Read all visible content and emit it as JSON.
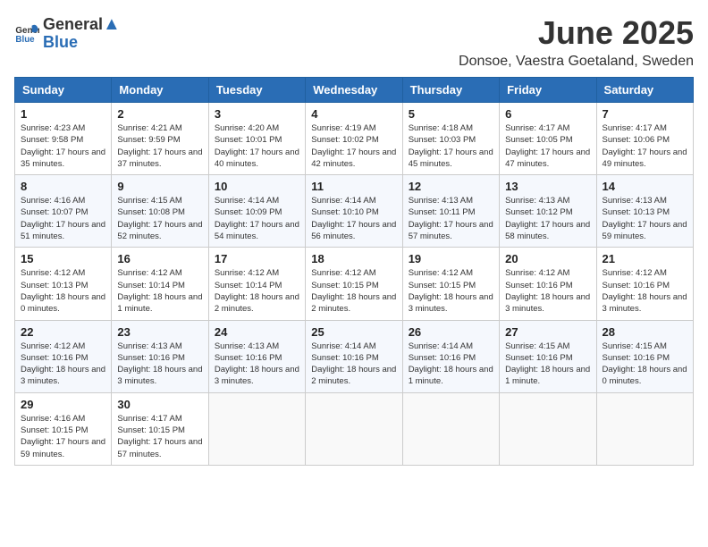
{
  "logo": {
    "text_general": "General",
    "text_blue": "Blue"
  },
  "title": "June 2025",
  "location": "Donsoe, Vaestra Goetaland, Sweden",
  "weekdays": [
    "Sunday",
    "Monday",
    "Tuesday",
    "Wednesday",
    "Thursday",
    "Friday",
    "Saturday"
  ],
  "weeks": [
    [
      {
        "day": "1",
        "rise": "4:23 AM",
        "set": "9:58 PM",
        "daylight": "17 hours and 35 minutes."
      },
      {
        "day": "2",
        "rise": "4:21 AM",
        "set": "9:59 PM",
        "daylight": "17 hours and 37 minutes."
      },
      {
        "day": "3",
        "rise": "4:20 AM",
        "set": "10:01 PM",
        "daylight": "17 hours and 40 minutes."
      },
      {
        "day": "4",
        "rise": "4:19 AM",
        "set": "10:02 PM",
        "daylight": "17 hours and 42 minutes."
      },
      {
        "day": "5",
        "rise": "4:18 AM",
        "set": "10:03 PM",
        "daylight": "17 hours and 45 minutes."
      },
      {
        "day": "6",
        "rise": "4:17 AM",
        "set": "10:05 PM",
        "daylight": "17 hours and 47 minutes."
      },
      {
        "day": "7",
        "rise": "4:17 AM",
        "set": "10:06 PM",
        "daylight": "17 hours and 49 minutes."
      }
    ],
    [
      {
        "day": "8",
        "rise": "4:16 AM",
        "set": "10:07 PM",
        "daylight": "17 hours and 51 minutes."
      },
      {
        "day": "9",
        "rise": "4:15 AM",
        "set": "10:08 PM",
        "daylight": "17 hours and 52 minutes."
      },
      {
        "day": "10",
        "rise": "4:14 AM",
        "set": "10:09 PM",
        "daylight": "17 hours and 54 minutes."
      },
      {
        "day": "11",
        "rise": "4:14 AM",
        "set": "10:10 PM",
        "daylight": "17 hours and 56 minutes."
      },
      {
        "day": "12",
        "rise": "4:13 AM",
        "set": "10:11 PM",
        "daylight": "17 hours and 57 minutes."
      },
      {
        "day": "13",
        "rise": "4:13 AM",
        "set": "10:12 PM",
        "daylight": "17 hours and 58 minutes."
      },
      {
        "day": "14",
        "rise": "4:13 AM",
        "set": "10:13 PM",
        "daylight": "17 hours and 59 minutes."
      }
    ],
    [
      {
        "day": "15",
        "rise": "4:12 AM",
        "set": "10:13 PM",
        "daylight": "18 hours and 0 minutes."
      },
      {
        "day": "16",
        "rise": "4:12 AM",
        "set": "10:14 PM",
        "daylight": "18 hours and 1 minute."
      },
      {
        "day": "17",
        "rise": "4:12 AM",
        "set": "10:14 PM",
        "daylight": "18 hours and 2 minutes."
      },
      {
        "day": "18",
        "rise": "4:12 AM",
        "set": "10:15 PM",
        "daylight": "18 hours and 2 minutes."
      },
      {
        "day": "19",
        "rise": "4:12 AM",
        "set": "10:15 PM",
        "daylight": "18 hours and 3 minutes."
      },
      {
        "day": "20",
        "rise": "4:12 AM",
        "set": "10:16 PM",
        "daylight": "18 hours and 3 minutes."
      },
      {
        "day": "21",
        "rise": "4:12 AM",
        "set": "10:16 PM",
        "daylight": "18 hours and 3 minutes."
      }
    ],
    [
      {
        "day": "22",
        "rise": "4:12 AM",
        "set": "10:16 PM",
        "daylight": "18 hours and 3 minutes."
      },
      {
        "day": "23",
        "rise": "4:13 AM",
        "set": "10:16 PM",
        "daylight": "18 hours and 3 minutes."
      },
      {
        "day": "24",
        "rise": "4:13 AM",
        "set": "10:16 PM",
        "daylight": "18 hours and 3 minutes."
      },
      {
        "day": "25",
        "rise": "4:14 AM",
        "set": "10:16 PM",
        "daylight": "18 hours and 2 minutes."
      },
      {
        "day": "26",
        "rise": "4:14 AM",
        "set": "10:16 PM",
        "daylight": "18 hours and 1 minute."
      },
      {
        "day": "27",
        "rise": "4:15 AM",
        "set": "10:16 PM",
        "daylight": "18 hours and 1 minute."
      },
      {
        "day": "28",
        "rise": "4:15 AM",
        "set": "10:16 PM",
        "daylight": "18 hours and 0 minutes."
      }
    ],
    [
      {
        "day": "29",
        "rise": "4:16 AM",
        "set": "10:15 PM",
        "daylight": "17 hours and 59 minutes."
      },
      {
        "day": "30",
        "rise": "4:17 AM",
        "set": "10:15 PM",
        "daylight": "17 hours and 57 minutes."
      },
      null,
      null,
      null,
      null,
      null
    ]
  ]
}
